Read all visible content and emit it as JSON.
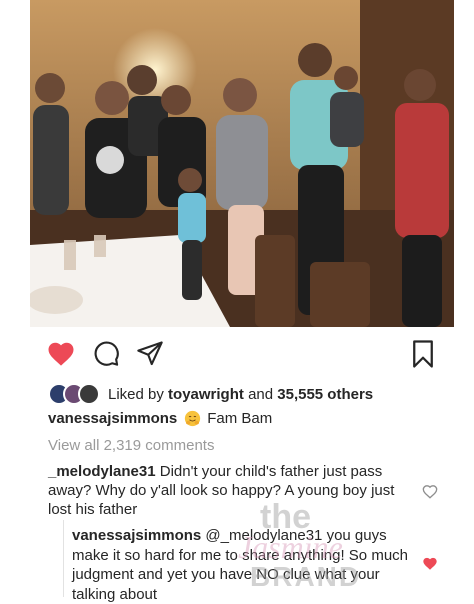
{
  "post": {
    "photo_alt": "",
    "likes": {
      "prefix": "Liked by",
      "user": "toyawright",
      "connector": "and",
      "count_text": "35,555 others"
    },
    "caption": {
      "username": "vanessajsimmons",
      "text": "Fam Bam"
    },
    "view_all": "View all 2,319 comments",
    "comments": [
      {
        "username": "_melodylane31",
        "text": "Didn't your child's father just pass away? Why do y'all look so happy? A young boy just lost his father",
        "liked": false
      }
    ],
    "reply": {
      "username": "vanessajsimmons",
      "mention": "@_melodylane31",
      "text": "you guys make it so hard for me to share anything! So much judgment and yet you have NO clue what your talking about",
      "liked": true
    }
  },
  "watermark": {
    "line1": "the",
    "line2": "Jasmine",
    "line3": "BRAND"
  },
  "colors": {
    "like_red": "#ed4956",
    "text": "#262626",
    "muted": "#9a9a9a"
  }
}
